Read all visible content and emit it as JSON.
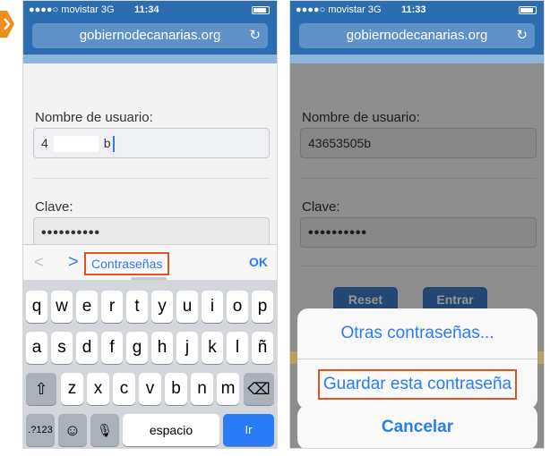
{
  "left": {
    "status": {
      "carrier": "●●●●○ movistar  3G",
      "time": "11:34"
    },
    "url": "gobiernodecanarias.org",
    "form": {
      "username_label": "Nombre de usuario:",
      "username_prefix": "4",
      "username_suffix": "b",
      "password_label": "Clave:",
      "password_value": "••••••••••"
    },
    "accessory": {
      "prev": "<",
      "next": ">",
      "passwords": "Contraseñas",
      "ok": "OK"
    },
    "keyboard": {
      "row1": [
        "q",
        "w",
        "e",
        "r",
        "t",
        "y",
        "u",
        "i",
        "o",
        "p"
      ],
      "row2": [
        "a",
        "s",
        "d",
        "f",
        "g",
        "h",
        "j",
        "k",
        "l",
        "ñ"
      ],
      "row3": [
        "z",
        "x",
        "c",
        "v",
        "b",
        "n",
        "m"
      ],
      "shift": "⇧",
      "backspace": "⌫",
      "numbers": ".?123",
      "emoji": "☺",
      "mic": "🎙",
      "space": "espacio",
      "go": "Ir"
    }
  },
  "right": {
    "status": {
      "carrier": "●●●●○ movistar  3G",
      "time": "11:33"
    },
    "url": "gobiernodecanarias.org",
    "form": {
      "username_label": "Nombre de usuario:",
      "username_value": "43653505b",
      "password_label": "Clave:",
      "password_value": "••••••••••",
      "reset": "Reset",
      "submit": "Entrar"
    },
    "sheet": {
      "other": "Otras contraseñas...",
      "save": "Guardar esta contraseña",
      "cancel": "Cancelar"
    }
  },
  "colors": {
    "accent": "#2a7cf6",
    "highlight": "#e2541f",
    "header": "#2c6db1",
    "tab": "#f28c1e"
  }
}
